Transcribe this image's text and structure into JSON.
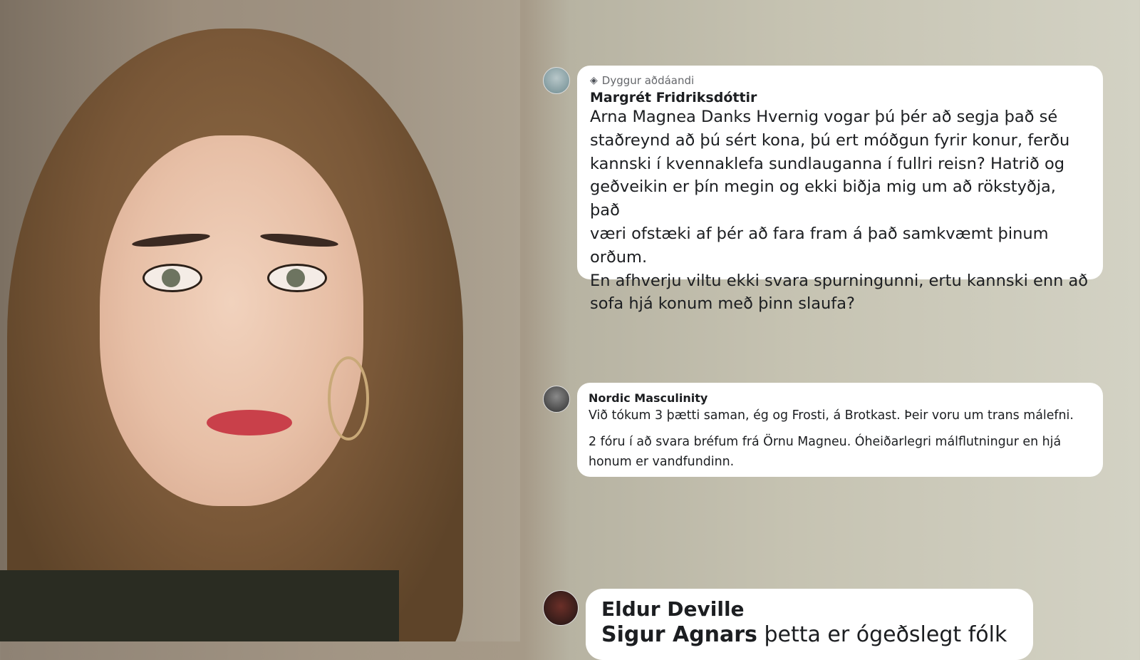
{
  "comments": [
    {
      "badge": "Dyggur aðdáandi",
      "author": "Margrét Fridriksdóttir",
      "lines": [
        "Arna Magnea Danks Hvernig vogar þú þér að segja það sé",
        "staðreynd að þú sért kona, þú ert móðgun fyrir konur, ferðu",
        "kannski í kvennaklefa sundlauganna í fullri reisn? Hatrið og",
        "geðveikin er þín megin og ekki biðja mig um að rökstyðja, það",
        "væri ofstæki af þér að fara fram á það samkvæmt þinum orðum.",
        "En afhverju viltu ekki svara spurningunni, ertu kannski enn að",
        "sofa hjá konum með þinn slaufa?"
      ]
    },
    {
      "author": "Nordic Masculinity",
      "paragraph1": "Við tókum 3 þætti saman, ég og Frosti, á Brotkast. Þeir voru um trans málefni.",
      "paragraph2_lines": [
        "2 fóru í að svara bréfum frá Örnu Magneu. Óheiðarlegri málflutningur en hjá",
        "honum er vandfundinn."
      ]
    },
    {
      "author": "Eldur Deville",
      "mention": "Sigur Agnars",
      "text": " þetta er ógeðslegt fólk"
    }
  ],
  "icons": {
    "badge": "diamond-icon"
  }
}
